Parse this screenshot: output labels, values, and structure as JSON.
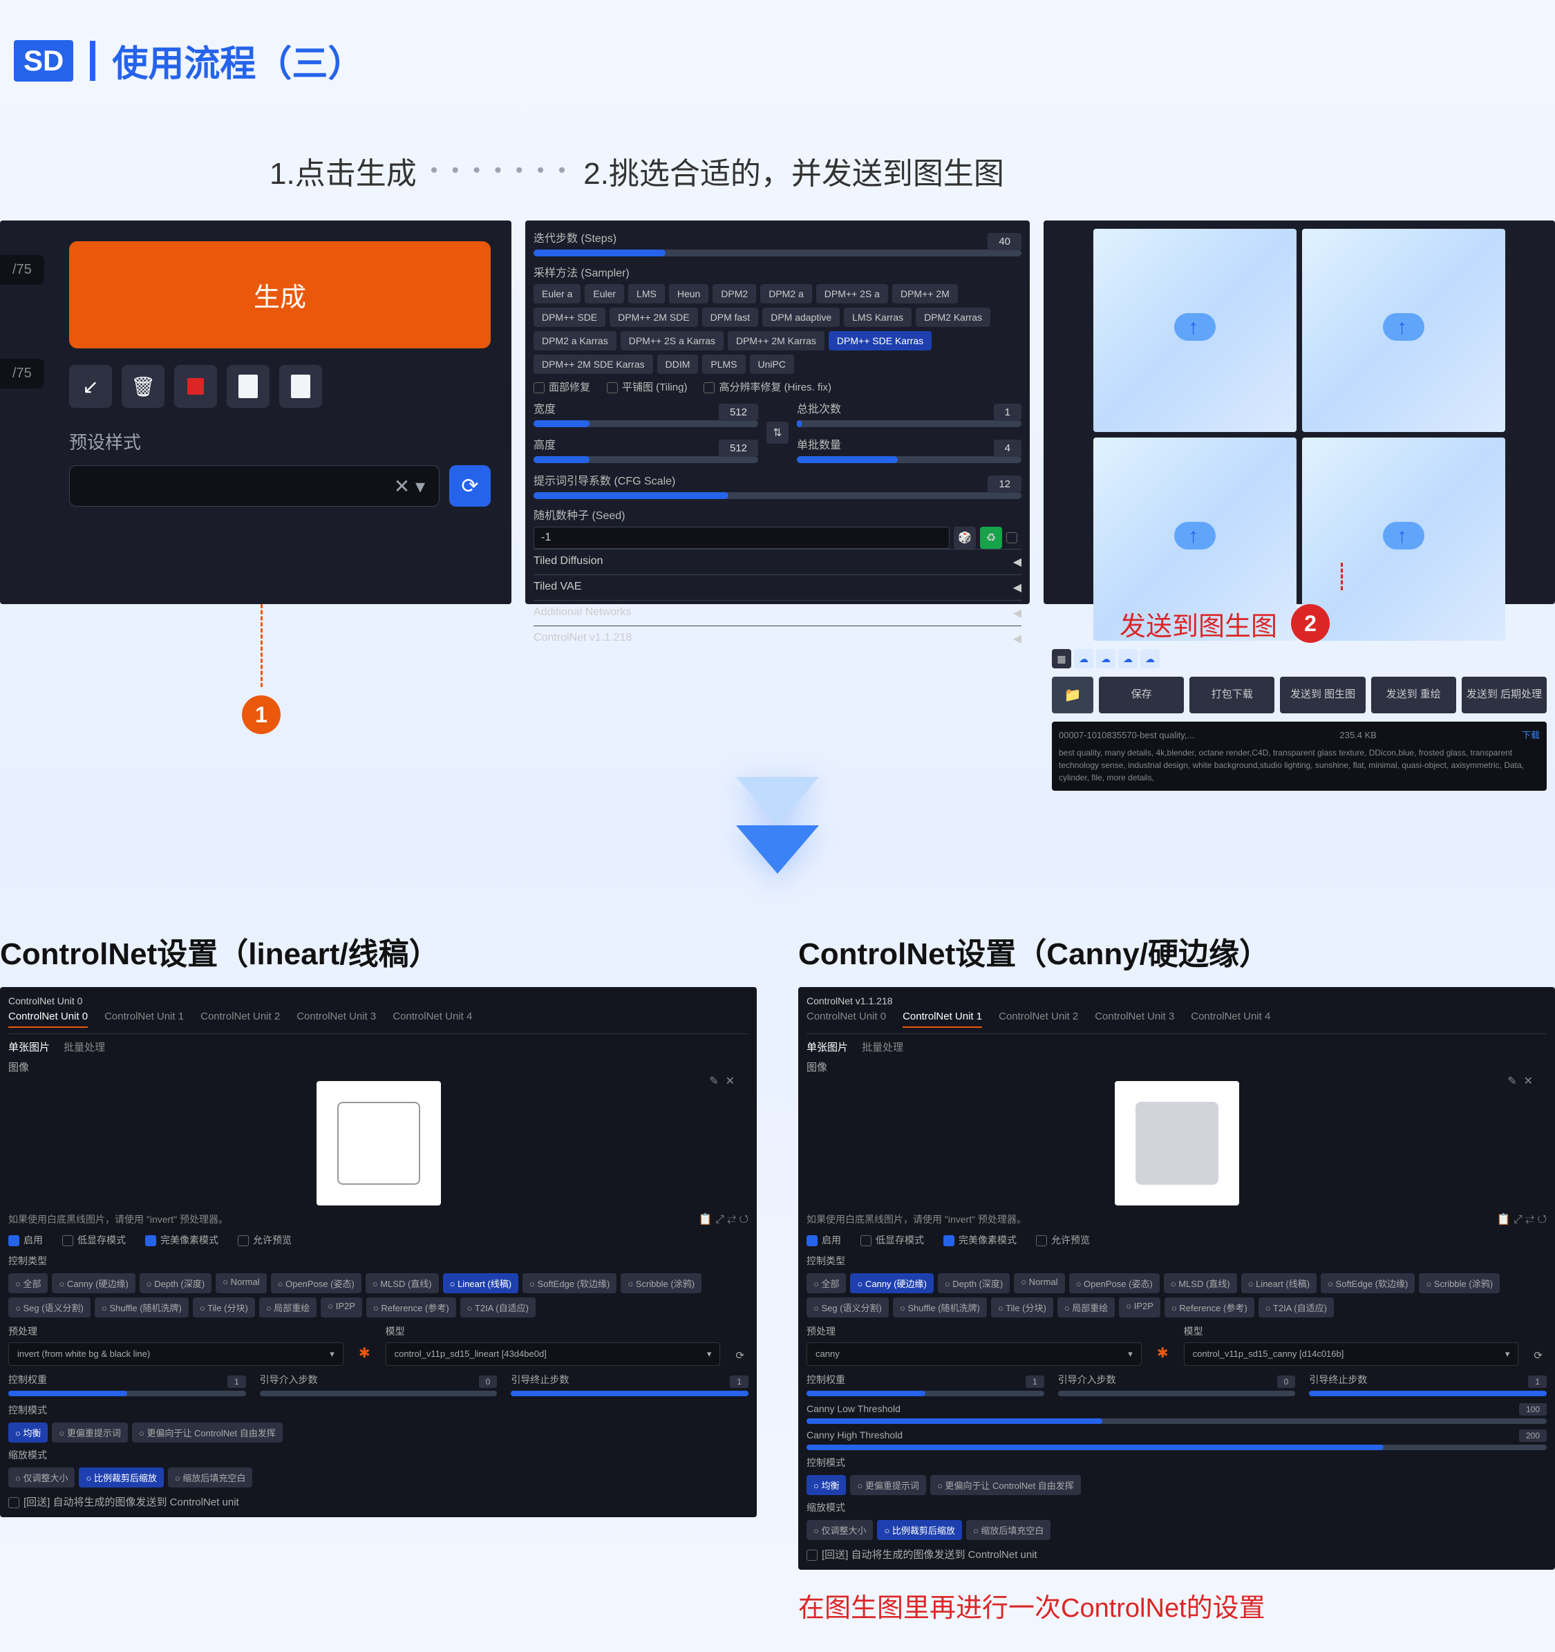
{
  "header": {
    "badge": "SD",
    "title": "使用流程（三）"
  },
  "steps": {
    "s1": "1.点击生成",
    "s2": "2.挑选合适的，并发送到图生图"
  },
  "p1": {
    "token": "/75",
    "generate": "生成",
    "preset_label": "预设样式",
    "clear": "✕ ▾"
  },
  "p2": {
    "steps_lbl": "迭代步数 (Steps)",
    "steps_val": "40",
    "sampler_lbl": "采样方法 (Sampler)",
    "samplers": [
      "Euler a",
      "Euler",
      "LMS",
      "Heun",
      "DPM2",
      "DPM2 a",
      "DPM++ 2S a",
      "DPM++ 2M",
      "DPM++ SDE",
      "DPM++ 2M SDE",
      "DPM fast",
      "DPM adaptive",
      "LMS Karras",
      "DPM2 Karras",
      "DPM2 a Karras",
      "DPM++ 2S a Karras",
      "DPM++ 2M Karras",
      "DPM++ SDE Karras",
      "DPM++ 2M SDE Karras",
      "DDIM",
      "PLMS",
      "UniPC"
    ],
    "sampler_active": "DPM++ SDE Karras",
    "restore": "面部修复",
    "tiling": "平铺图 (Tiling)",
    "hires": "高分辨率修复 (Hires. fix)",
    "width_lbl": "宽度",
    "width_val": "512",
    "height_lbl": "高度",
    "height_val": "512",
    "batch_count_lbl": "总批次数",
    "batch_count_val": "1",
    "batch_size_lbl": "单批数量",
    "batch_size_val": "4",
    "cfg_lbl": "提示词引导系数 (CFG Scale)",
    "cfg_val": "12",
    "seed_lbl": "随机数种子 (Seed)",
    "seed_val": "-1",
    "acc": [
      "Tiled Diffusion",
      "Tiled VAE",
      "Additional Networks",
      "ControlNet v1.1.218"
    ]
  },
  "p3": {
    "actions": [
      "保存",
      "打包下载",
      "发送到 图生图",
      "发送到 重绘",
      "发送到 后期处理"
    ],
    "meta_name": "00007-1010835570-best quality,...",
    "meta_size": "235.4 KB",
    "download": "下载",
    "meta_full": "best quality, many details, 4k,blender, octane render,C4D, transparent glass texture, DDicon,blue, frosted glass, transparent technology sense, industrial design, white background,studio lighting, sunshine, flat, minimal, quasi-object, axisymmetric, Data, cylinder, file, more details,"
  },
  "callouts": {
    "send": "发送到图生图"
  },
  "cn": {
    "title_l": "ControlNet设置（lineart/线稿）",
    "title_r": "ControlNet设置（Canny/硬边缘）",
    "hdr_l": "ControlNet Unit 0",
    "hdr_r": "ControlNet v1.1.218",
    "tabs": [
      "ControlNet Unit 0",
      "ControlNet Unit 1",
      "ControlNet Unit 2",
      "ControlNet Unit 3",
      "ControlNet Unit 4"
    ],
    "subtabs": [
      "单张图片",
      "批量处理"
    ],
    "img_lbl": "图像",
    "note": "如果使用白底黑线图片，请使用 \"invert\" 预处理器。",
    "chks": [
      "启用",
      "低显存模式",
      "完美像素模式",
      "允许预览"
    ],
    "ctrl_type": "控制类型",
    "types": [
      "全部",
      "Canny (硬边缘)",
      "Depth (深度)",
      "Normal",
      "OpenPose (姿态)",
      "MLSD (直线)",
      "Lineart (线稿)",
      "SoftEdge (软边缘)",
      "Scribble (涂鸦)",
      "Seg (语义分割)",
      "Shuffle (随机洗牌)",
      "Tile (分块)",
      "局部重绘",
      "IP2P",
      "Reference (参考)",
      "T2IA (自适应)"
    ],
    "type_act_l": "Lineart (线稿)",
    "type_act_r": "Canny (硬边缘)",
    "preproc_lbl": "预处理",
    "model_lbl": "模型",
    "preproc_l": "invert (from white bg & black line)",
    "model_l": "control_v11p_sd15_lineart [43d4be0d]",
    "preproc_r": "canny",
    "model_r": "control_v11p_sd15_canny [d14c016b]",
    "w_lbl": "控制权重",
    "w_val": "1",
    "start_lbl": "引导介入步数",
    "start_val": "0",
    "end_lbl": "引导终止步数",
    "end_val": "1",
    "canny_low": "Canny Low Threshold",
    "canny_low_v": "100",
    "canny_high": "Canny High Threshold",
    "canny_high_v": "200",
    "mode_lbl": "控制模式",
    "modes": [
      "均衡",
      "更偏重提示词",
      "更偏向于让 ControlNet 自由发挥"
    ],
    "resize_lbl": "缩放模式",
    "resizes": [
      "仅调整大小",
      "比例裁剪后缩放",
      "缩放后填充空白"
    ],
    "loopback": "[回送] 自动将生成的图像发送到 ControlNet unit",
    "bottom": "在图生图里再进行一次ControlNet的设置"
  }
}
